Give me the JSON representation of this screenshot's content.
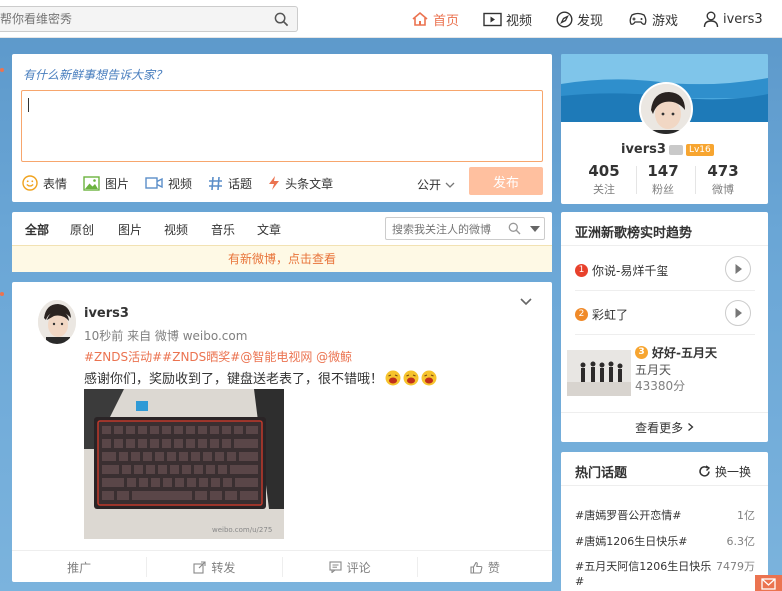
{
  "topbar": {
    "search_placeholder": "帮你看维密秀",
    "nav": [
      {
        "label": "首页",
        "icon": "home-icon",
        "active": true
      },
      {
        "label": "视频",
        "icon": "video-icon",
        "active": false
      },
      {
        "label": "发现",
        "icon": "compass-icon",
        "active": false
      },
      {
        "label": "游戏",
        "icon": "gamepad-icon",
        "active": false
      },
      {
        "label": "ivers3",
        "icon": "user-icon",
        "active": false
      }
    ]
  },
  "publisher": {
    "prompt": "有什么新鲜事想告诉大家？",
    "tools": [
      {
        "label": "表情",
        "icon": "smile-icon"
      },
      {
        "label": "图片",
        "icon": "image-icon"
      },
      {
        "label": "视频",
        "icon": "video-icon"
      },
      {
        "label": "话题",
        "icon": "hashtag-icon"
      },
      {
        "label": "头条文章",
        "icon": "lightning-icon"
      }
    ],
    "visibility": "公开",
    "submit_label": "发布"
  },
  "feed": {
    "tabs": [
      "全部",
      "原创",
      "图片",
      "视频",
      "音乐",
      "文章"
    ],
    "active_tab": "全部",
    "search_placeholder": "搜索我关注人的微博",
    "notice": "有新微博，点击查看"
  },
  "post": {
    "user": "ivers3",
    "meta": "10秒前 来自 微博 weibo.com",
    "topics": "#ZNDS活动##ZNDS晒奖#@智能电视网 @微鲸",
    "text": "感谢你们，奖励收到了，键盘送老表了，很不错哦！",
    "image_watermark": "weibo.com/u/275",
    "actions": [
      {
        "label": "推广",
        "icon": ""
      },
      {
        "label": "转发",
        "icon": "share-icon"
      },
      {
        "label": "评论",
        "icon": "comment-icon"
      },
      {
        "label": "赞",
        "icon": "thumbs-up-icon"
      }
    ]
  },
  "profile": {
    "name": "ivers3",
    "level": "Lv16",
    "stats": [
      {
        "num": "405",
        "label": "关注"
      },
      {
        "num": "147",
        "label": "粉丝"
      },
      {
        "num": "473",
        "label": "微博"
      }
    ]
  },
  "chart": {
    "title": "亚洲新歌榜实时趋势",
    "songs": [
      {
        "rank": "1",
        "title": "你说-易烊千玺",
        "color": "#e8412c"
      },
      {
        "rank": "2",
        "title": "彩虹了",
        "color": "#f08a29"
      },
      {
        "rank": "3",
        "title": "好好-五月天",
        "artist": "五月天",
        "score": "43380分",
        "color": "#f7a530"
      }
    ],
    "more": "查看更多"
  },
  "hot_topics": {
    "title": "热门话题",
    "refresh": "换一换",
    "items": [
      {
        "title": "#唐嫣罗晋公开恋情#",
        "count": "1亿"
      },
      {
        "title": "#唐嫣1206生日快乐#",
        "count": "6.3亿"
      },
      {
        "title": "#五月天阿信1206生日快乐#",
        "count": "7479万"
      }
    ]
  },
  "colors": {
    "accent": "#eb7350",
    "link": "#eb7350",
    "submit_disabled": "#ffc09f"
  }
}
